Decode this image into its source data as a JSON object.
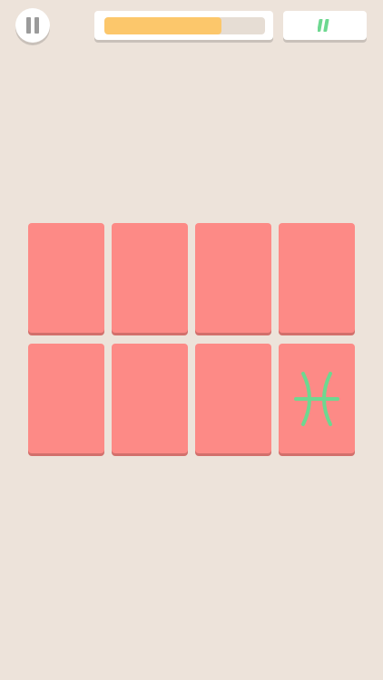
{
  "colors": {
    "background": "#ede3da",
    "card_back": "#fd8a86",
    "symbol": "#6dd890",
    "progress_fill": "#fcc76b",
    "progress_track": "#e6ddd4",
    "button": "#ffffff",
    "icon_gray": "#9b9b9b"
  },
  "header": {
    "pause_icon": "pause-icon",
    "timer_progress": 0.73,
    "score_icon": "tally-marks-icon",
    "score_tally": 2
  },
  "board": {
    "rows": 2,
    "columns": 4,
    "cards": [
      {
        "state": "face-down"
      },
      {
        "state": "face-down"
      },
      {
        "state": "face-down"
      },
      {
        "state": "face-down"
      },
      {
        "state": "face-down"
      },
      {
        "state": "face-down"
      },
      {
        "state": "face-down"
      },
      {
        "state": "face-up",
        "symbol": "pisces-icon"
      }
    ]
  }
}
